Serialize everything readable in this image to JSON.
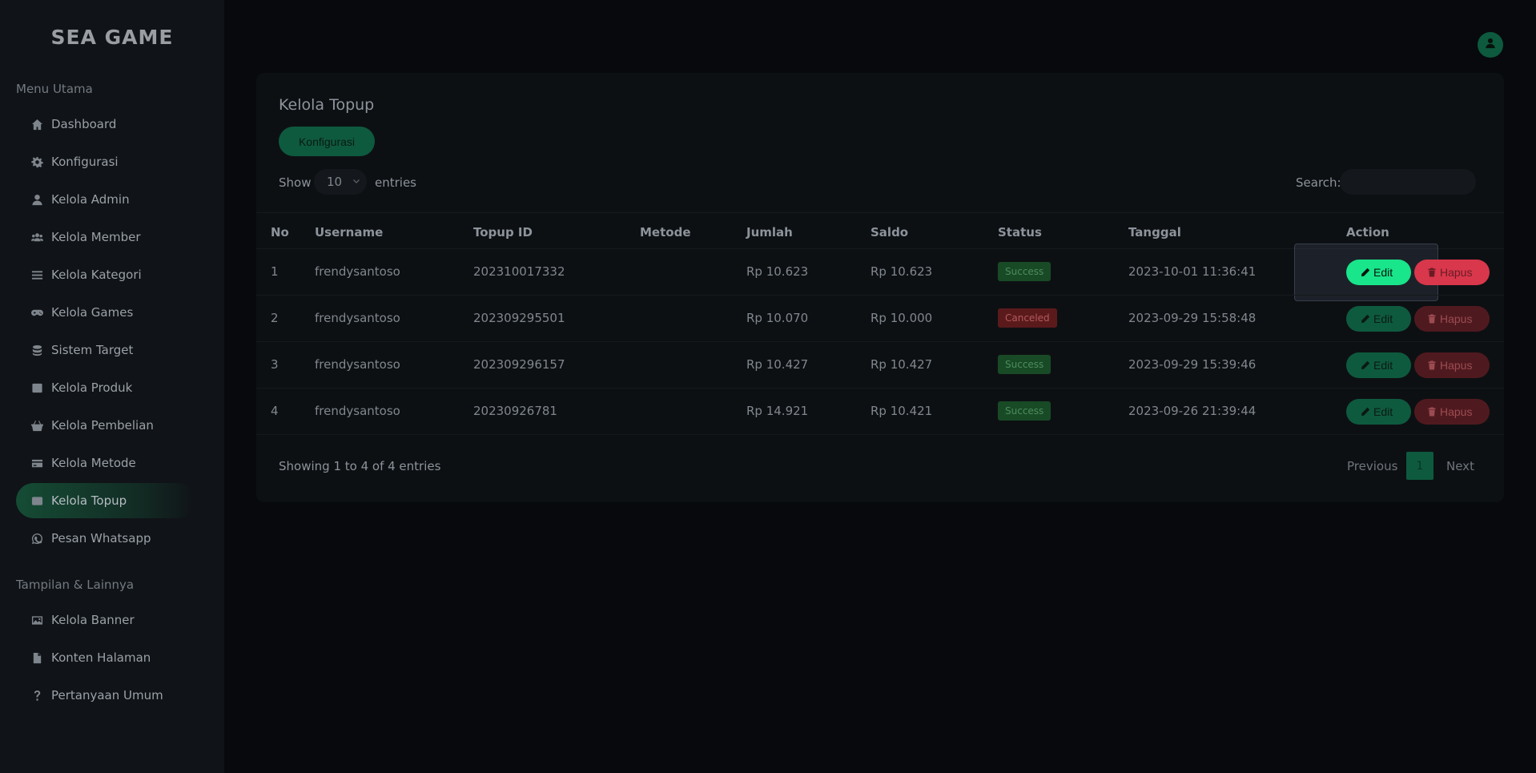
{
  "brand": {
    "logo_text": "SEA GAME"
  },
  "sidebar": {
    "sections": [
      {
        "title": "Menu Utama"
      },
      {
        "title": "Tampilan & Lainnya"
      }
    ],
    "items": [
      {
        "label": "Dashboard",
        "icon": "home-icon"
      },
      {
        "label": "Konfigurasi",
        "icon": "gear-icon"
      },
      {
        "label": "Kelola Admin",
        "icon": "user-icon"
      },
      {
        "label": "Kelola Member",
        "icon": "users-icon"
      },
      {
        "label": "Kelola Kategori",
        "icon": "list-icon"
      },
      {
        "label": "Kelola Games",
        "icon": "gamepad-icon"
      },
      {
        "label": "Sistem Target",
        "icon": "database-icon"
      },
      {
        "label": "Kelola Produk",
        "icon": "box-icon"
      },
      {
        "label": "Kelola Pembelian",
        "icon": "basket-icon"
      },
      {
        "label": "Kelola Metode",
        "icon": "credit-card-icon"
      },
      {
        "label": "Kelola Topup",
        "icon": "wallet-icon",
        "active": true
      },
      {
        "label": "Pesan Whatsapp",
        "icon": "whatsapp-icon"
      },
      {
        "label": "Kelola Banner",
        "icon": "image-icon"
      },
      {
        "label": "Konten Halaman",
        "icon": "file-icon"
      },
      {
        "label": "Pertanyaan Umum",
        "icon": "question-icon"
      }
    ]
  },
  "card": {
    "title": "Kelola Topup",
    "config_button": "Konfigurasi",
    "show_label": "Show",
    "entries_value": "10",
    "entries_label": "entries",
    "search_label": "Search:",
    "search_value": ""
  },
  "table": {
    "headers": [
      "No",
      "Username",
      "Topup ID",
      "Metode",
      "Jumlah",
      "Saldo",
      "Status",
      "Tanggal",
      "Action"
    ],
    "rows": [
      {
        "no": "1",
        "username": "frendysantoso",
        "topup_id": "202310017332",
        "metode": "",
        "jumlah": "Rp 10.623",
        "saldo": "Rp 10.623",
        "status": "Success",
        "tanggal": "2023-10-01 11:36:41"
      },
      {
        "no": "2",
        "username": "frendysantoso",
        "topup_id": "202309295501",
        "metode": "",
        "jumlah": "Rp 10.070",
        "saldo": "Rp 10.000",
        "status": "Canceled",
        "tanggal": "2023-09-29 15:58:48"
      },
      {
        "no": "3",
        "username": "frendysantoso",
        "topup_id": "202309296157",
        "metode": "",
        "jumlah": "Rp 10.427",
        "saldo": "Rp 10.427",
        "status": "Success",
        "tanggal": "2023-09-29 15:39:46"
      },
      {
        "no": "4",
        "username": "frendysantoso",
        "topup_id": "20230926781",
        "metode": "",
        "jumlah": "Rp 14.921",
        "saldo": "Rp 10.421",
        "status": "Success",
        "tanggal": "2023-09-26 21:39:44"
      }
    ],
    "edit_label": "Edit",
    "delete_label": "Hapus"
  },
  "footer": {
    "info": "Showing 1 to 4 of 4 entries",
    "previous": "Previous",
    "current_page": "1",
    "next": "Next"
  },
  "colors": {
    "accent": "#19e58b",
    "danger": "#d9374b",
    "background": "#07090c",
    "sidebar": "#101317"
  }
}
